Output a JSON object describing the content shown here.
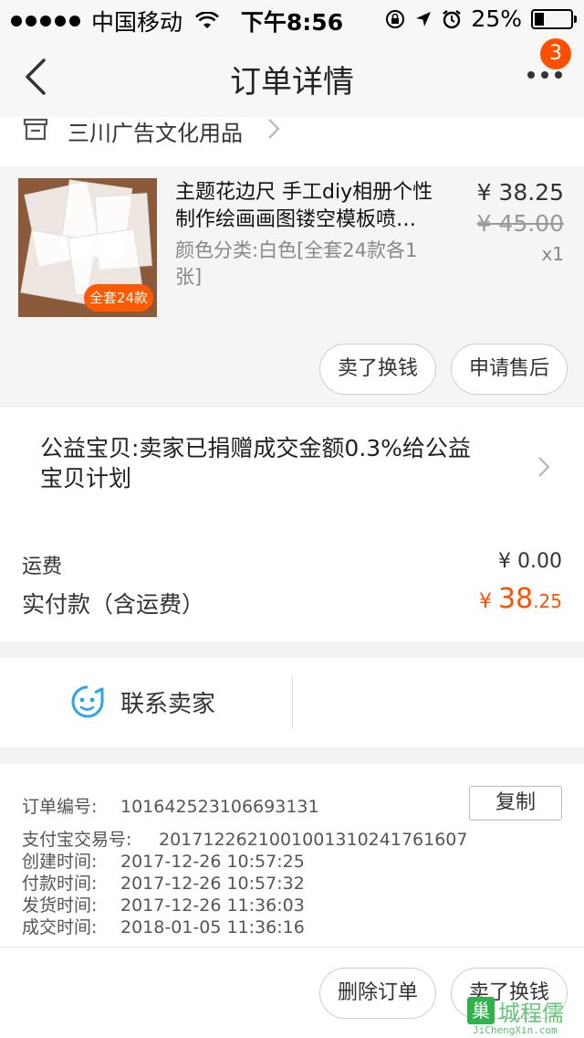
{
  "status_bar": {
    "carrier": "中国移动",
    "time": "下午8:56",
    "battery": "25%",
    "battery_level": 0.25
  },
  "nav": {
    "title": "订单详情",
    "badge": "3"
  },
  "shop": {
    "name": "三川广告文化用品"
  },
  "product": {
    "title_line1": "主题花边尺 手工diy相册个性",
    "title_line2": "制作绘画画图镂空模板喷…",
    "spec_line1": "颜色分类:白色[全套24款各1",
    "spec_line2": "张]",
    "price": "¥ 38.25",
    "original_price": "¥ 45.00",
    "quantity": "x1",
    "image_tag": "全套24款",
    "btn_sell": "卖了换钱",
    "btn_aftersale": "申请售后"
  },
  "charity": {
    "line1": "公益宝贝:卖家已捐赠成交金额0.3%给公益",
    "line2": "宝贝计划"
  },
  "totals": {
    "shipping_label": "运费",
    "shipping_value": "¥ 0.00",
    "paid_label": "实付款（含运费）",
    "paid_currency": "¥ ",
    "paid_int": "38",
    "paid_dec": ".25"
  },
  "contact": {
    "label": "联系卖家"
  },
  "order_info": {
    "copy_label": "复制",
    "rows": [
      {
        "key": "订单编号:",
        "value": "101642523106693131"
      },
      {
        "key": "支付宝交易号:",
        "value": "2017122621001001310241761607"
      },
      {
        "key": "创建时间:",
        "value": "2017-12-26 10:57:25"
      },
      {
        "key": "付款时间:",
        "value": "2017-12-26 10:57:32"
      },
      {
        "key": "发货时间:",
        "value": "2017-12-26 11:36:03"
      },
      {
        "key": "成交时间:",
        "value": "2018-01-05 11:36:16"
      }
    ]
  },
  "footer": {
    "btn_delete": "删除订单",
    "btn_sell": "卖了换钱"
  },
  "watermark": {
    "box": "巢",
    "text": "城程儒",
    "url": "JiChengXin.com"
  },
  "colors": {
    "accent": "#ff5000",
    "badge": "#ff5000",
    "contact_icon": "#2aa5e6",
    "watermark": "#2fb34a"
  }
}
